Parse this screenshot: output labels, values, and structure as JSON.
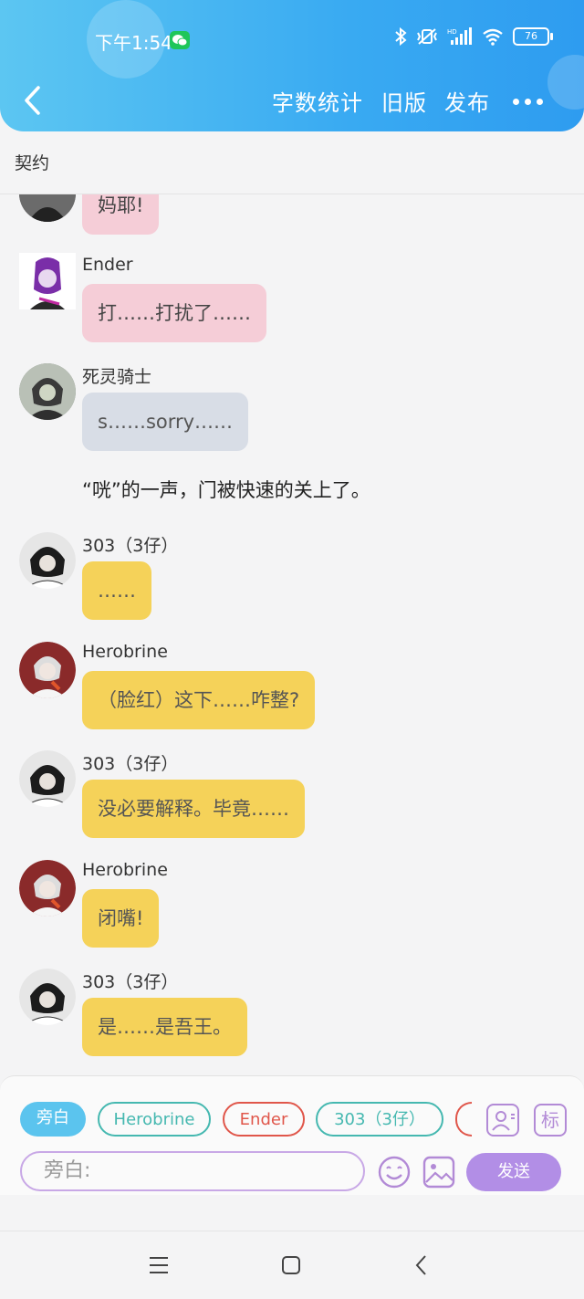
{
  "status_bar": {
    "time": "下午1:54",
    "battery": "76"
  },
  "nav": {
    "word_count": "字数统计",
    "old_version": "旧版",
    "publish": "发布"
  },
  "title": "契约",
  "messages": [
    {
      "name": "",
      "text": "妈耶!",
      "color": "pink"
    },
    {
      "name": "Ender",
      "text": "打……打扰了……",
      "color": "pink"
    },
    {
      "name": "死灵骑士",
      "text": "s……sorry……",
      "color": "gray"
    },
    {
      "narration": "“咣”的一声，门被快速的关上了。"
    },
    {
      "name": "303（3仔）",
      "text": "……",
      "color": "yellow"
    },
    {
      "name": "Herobrine",
      "text": "（脸红）这下……咋整?",
      "color": "yellow"
    },
    {
      "name": "303（3仔）",
      "text": "没必要解释。毕竟……",
      "color": "yellow"
    },
    {
      "name": "Herobrine",
      "text": "闭嘴!",
      "color": "yellow"
    },
    {
      "name": "303（3仔）",
      "text": "是……是吾王。",
      "color": "yellow"
    }
  ],
  "composer": {
    "chips": [
      "旁白",
      "Herobrine",
      "Ender",
      "303（3仔）"
    ],
    "tag_label": "标",
    "placeholder": "旁白:",
    "send": "发送"
  },
  "colors": {
    "header": "#39aaf2",
    "pink_bubble": "#f5cdd7",
    "gray_bubble": "#d8dde6",
    "yellow_bubble": "#f5d259",
    "send": "#b28ee6"
  }
}
